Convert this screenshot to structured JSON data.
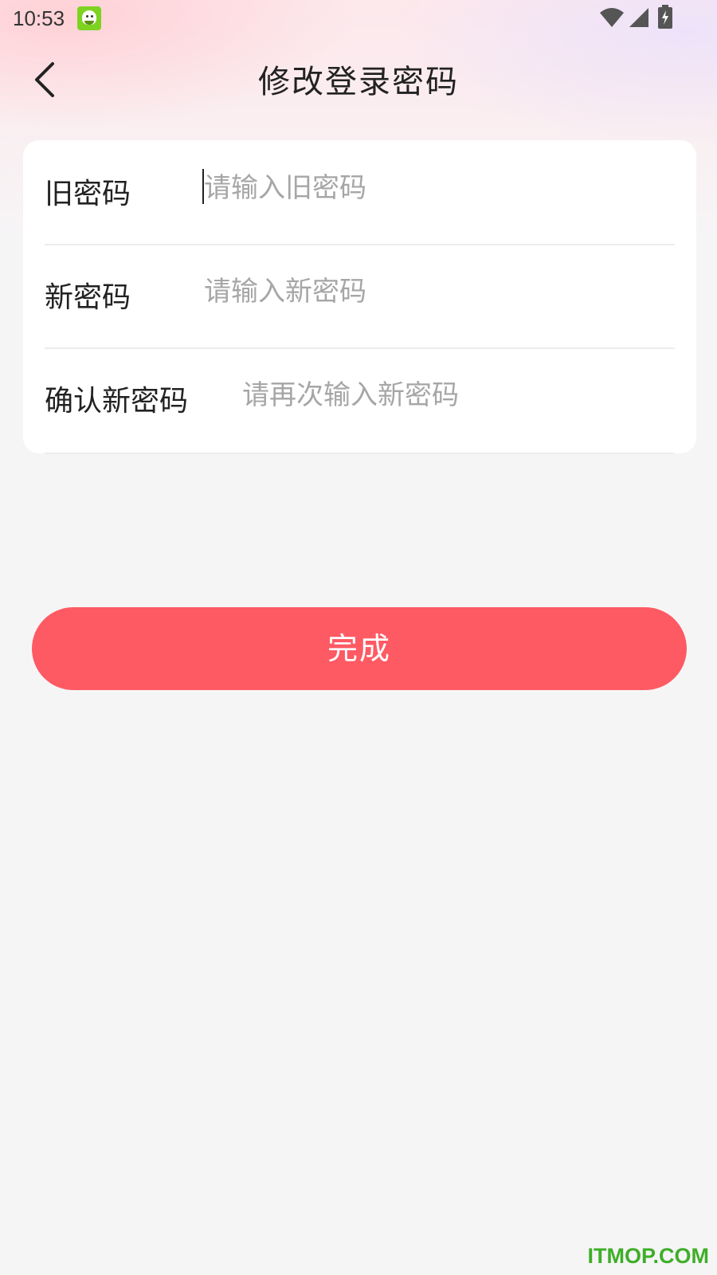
{
  "status_bar": {
    "time": "10:53",
    "icons": [
      "app-notification-icon",
      "wifi-icon",
      "signal-icon",
      "battery-charging-icon"
    ]
  },
  "header": {
    "back_icon": "chevron-left-icon",
    "title": "修改登录密码"
  },
  "form": {
    "fields": [
      {
        "label": "旧密码",
        "value": "",
        "placeholder": "请输入旧密码",
        "focused": true
      },
      {
        "label": "新密码",
        "value": "",
        "placeholder": "请输入新密码",
        "focused": false
      },
      {
        "label": "确认新密码",
        "value": "",
        "placeholder": "请再次输入新密码",
        "focused": false
      }
    ]
  },
  "done_button": {
    "label": "完成"
  },
  "watermark": "ITMOP.COM",
  "colors": {
    "accent": "#fe5a63",
    "background": "#f6f5f6",
    "card": "#ffffff",
    "watermark": "#3fae29"
  }
}
